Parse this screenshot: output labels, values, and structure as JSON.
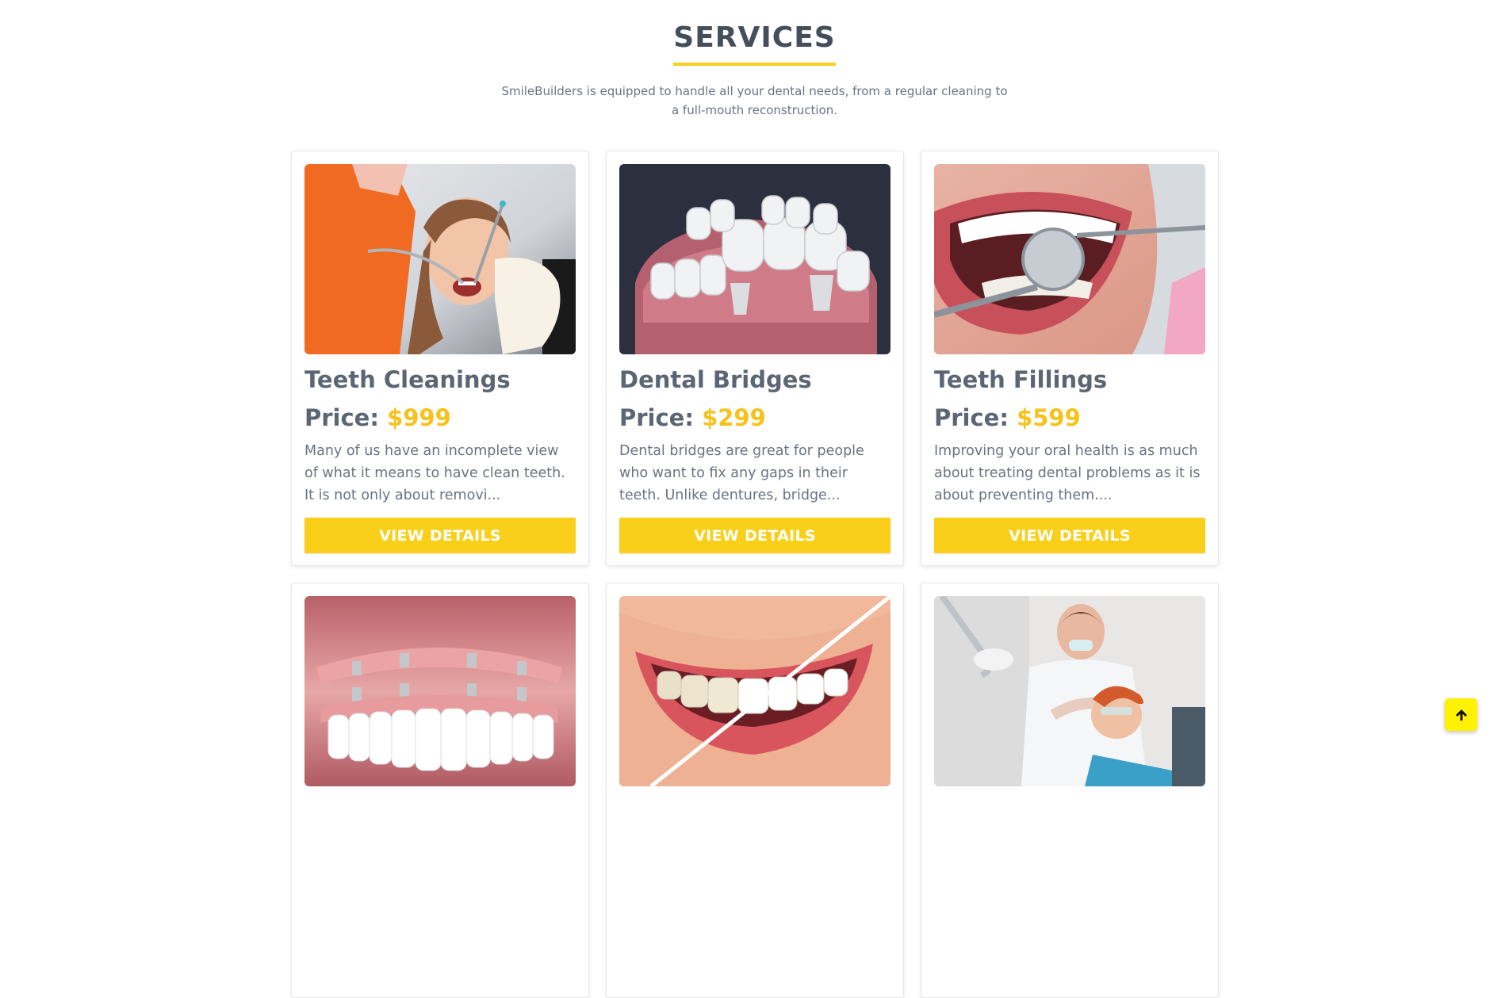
{
  "section": {
    "title": "SERVICES",
    "subtitle": "SmileBuilders is equipped to handle all your dental needs, from a regular cleaning to a full-mouth reconstruction."
  },
  "services": [
    {
      "title": "Teeth Cleanings",
      "price_label": "Price:",
      "price": "$999",
      "description": "Many of us have an incomplete view of what it means to have clean teeth. It is not only about removi...",
      "button_label": "VIEW DETAILS",
      "image": "teeth-cleaning-photo"
    },
    {
      "title": "Dental Bridges",
      "price_label": "Price:",
      "price": "$299",
      "description": "Dental bridges are great for people who want to fix any gaps in their teeth. Unlike dentures, bridge...",
      "button_label": "VIEW DETAILS",
      "image": "dental-bridge-render"
    },
    {
      "title": "Teeth Fillings",
      "price_label": "Price:",
      "price": "$599",
      "description": "Improving your oral health is as much about treating dental problems as it is about preventing them....",
      "button_label": "VIEW DETAILS",
      "image": "teeth-filling-photo"
    },
    {
      "image": "dental-implants-render"
    },
    {
      "image": "teeth-whitening-photo"
    },
    {
      "image": "dentist-patient-photo"
    }
  ],
  "colors": {
    "accent": "#f9cf1a",
    "price": "#f6c21b",
    "title": "#454f5c",
    "scroll_top": "#fff200"
  },
  "scroll_top_icon": "arrow-up-icon"
}
